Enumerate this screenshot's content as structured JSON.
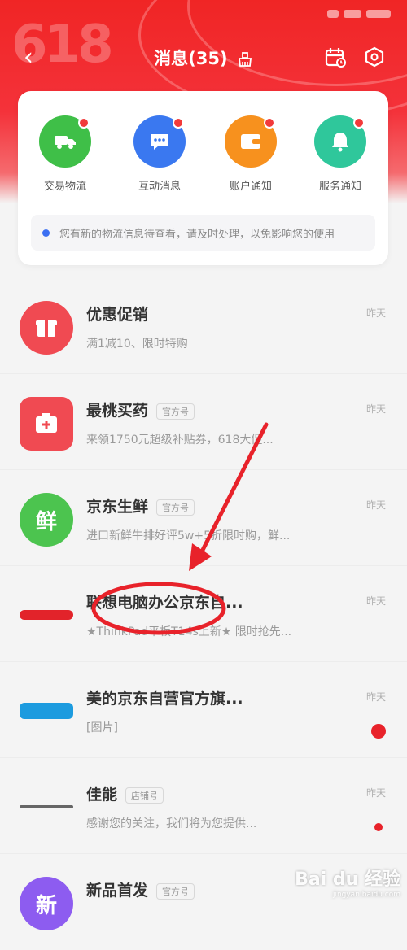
{
  "header": {
    "promo_badge": "618",
    "title": "消息(35)",
    "back_glyph": "‹"
  },
  "icons": {
    "back": "back-chevron-icon",
    "clean": "broom-icon",
    "calendar": "calendar-icon",
    "settings": "settings-hexagon-icon"
  },
  "categories": [
    {
      "label": "交易物流",
      "color": "#3fbf48",
      "icon": "truck-icon"
    },
    {
      "label": "互动消息",
      "color": "#3a78f0",
      "icon": "chat-bubble-icon"
    },
    {
      "label": "账户通知",
      "color": "#f7911e",
      "icon": "wallet-icon"
    },
    {
      "label": "服务通知",
      "color": "#2fc79b",
      "icon": "bell-icon"
    }
  ],
  "notice": {
    "text": "您有新的物流信息待查看，请及时处理，以免影响您的使用"
  },
  "messages": [
    {
      "name": "优惠促销",
      "tag": "",
      "preview": "满1减10、限时特购",
      "time": "昨天",
      "avatar_text": "",
      "avatar_color": "#f04a52",
      "avatar_type": "circle",
      "badge": "none"
    },
    {
      "name": "最桃买药",
      "tag": "官方号",
      "preview": "来领1750元超级补贴券，618大促...",
      "time": "昨天",
      "avatar_text": "",
      "avatar_color": "#f04a52",
      "avatar_type": "circle",
      "badge": "none"
    },
    {
      "name": "京东生鲜",
      "tag": "官方号",
      "preview": "进口新鲜牛排好评5w+5折限时购，鲜...",
      "time": "昨天",
      "avatar_text": "鲜",
      "avatar_color": "#4cc44f",
      "avatar_type": "circle",
      "badge": "none"
    },
    {
      "name": "联想电脑办公京东自...",
      "tag": "",
      "preview": "★ThinkPad平板T14s上新★ 限时抢先...",
      "time": "昨天",
      "avatar_text": "",
      "avatar_color": "#e2232a",
      "avatar_type": "logo",
      "badge": "none"
    },
    {
      "name": "美的京东自营官方旗...",
      "tag": "",
      "preview": "[图片]",
      "time": "昨天",
      "avatar_text": "",
      "avatar_color": "#1c9bdf",
      "avatar_type": "logo",
      "badge": "large"
    },
    {
      "name": "佳能",
      "tag": "店铺号",
      "preview": "感谢您的关注，我们将为您提供...",
      "time": "昨天",
      "avatar_text": "",
      "avatar_color": "#555555",
      "avatar_type": "logo-thin",
      "badge": "small"
    },
    {
      "name": "新品首发",
      "tag": "官方号",
      "preview": "",
      "time": "",
      "avatar_text": "新",
      "avatar_color": "#8d5cf0",
      "avatar_type": "circle",
      "badge": "none"
    }
  ],
  "watermark": {
    "brand": "Bai du 经验",
    "url": "jingyan.baidu.com"
  },
  "colors": {
    "brand_red": "#f02525",
    "annotation_red": "#e8222a"
  }
}
